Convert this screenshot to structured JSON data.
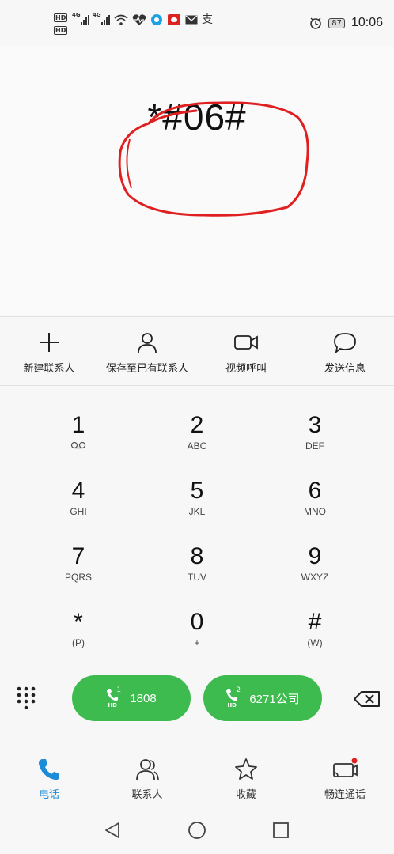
{
  "status_bar": {
    "hd_badge_1": "HD",
    "hd_badge_2": "HD",
    "network_1": "4G",
    "network_2": "4G",
    "alipay_glyph": "支",
    "battery": "87",
    "time": "10:06"
  },
  "dialer": {
    "dialed_number": "*#06#"
  },
  "actions": [
    {
      "label": "新建联系人",
      "icon": "plus-icon"
    },
    {
      "label": "保存至已有联系人",
      "icon": "person-icon"
    },
    {
      "label": "视频呼叫",
      "icon": "video-icon"
    },
    {
      "label": "发送信息",
      "icon": "message-icon"
    }
  ],
  "keypad": {
    "keys": [
      {
        "digit": "1",
        "sub": "voicemail"
      },
      {
        "digit": "2",
        "sub": "ABC"
      },
      {
        "digit": "3",
        "sub": "DEF"
      },
      {
        "digit": "4",
        "sub": "GHI"
      },
      {
        "digit": "5",
        "sub": "JKL"
      },
      {
        "digit": "6",
        "sub": "MNO"
      },
      {
        "digit": "7",
        "sub": "PQRS"
      },
      {
        "digit": "8",
        "sub": "TUV"
      },
      {
        "digit": "9",
        "sub": "WXYZ"
      },
      {
        "digit": "*",
        "sub": "(P)"
      },
      {
        "digit": "0",
        "sub": "+"
      },
      {
        "digit": "#",
        "sub": "(W)"
      }
    ]
  },
  "call_buttons": [
    {
      "sim": "1",
      "hd": "HD",
      "number": "1808"
    },
    {
      "sim": "2",
      "hd": "HD",
      "number": "6271公司"
    }
  ],
  "bottom_nav": [
    {
      "label": "电话",
      "icon": "phone-icon",
      "active": true
    },
    {
      "label": "联系人",
      "icon": "contacts-icon",
      "active": false
    },
    {
      "label": "收藏",
      "icon": "star-icon",
      "active": false
    },
    {
      "label": "畅连通话",
      "icon": "screen-share-icon",
      "active": false
    }
  ],
  "colors": {
    "call_green": "#3dbb4f",
    "active_blue": "#1a8cd8",
    "annotation_red": "#e02020"
  }
}
